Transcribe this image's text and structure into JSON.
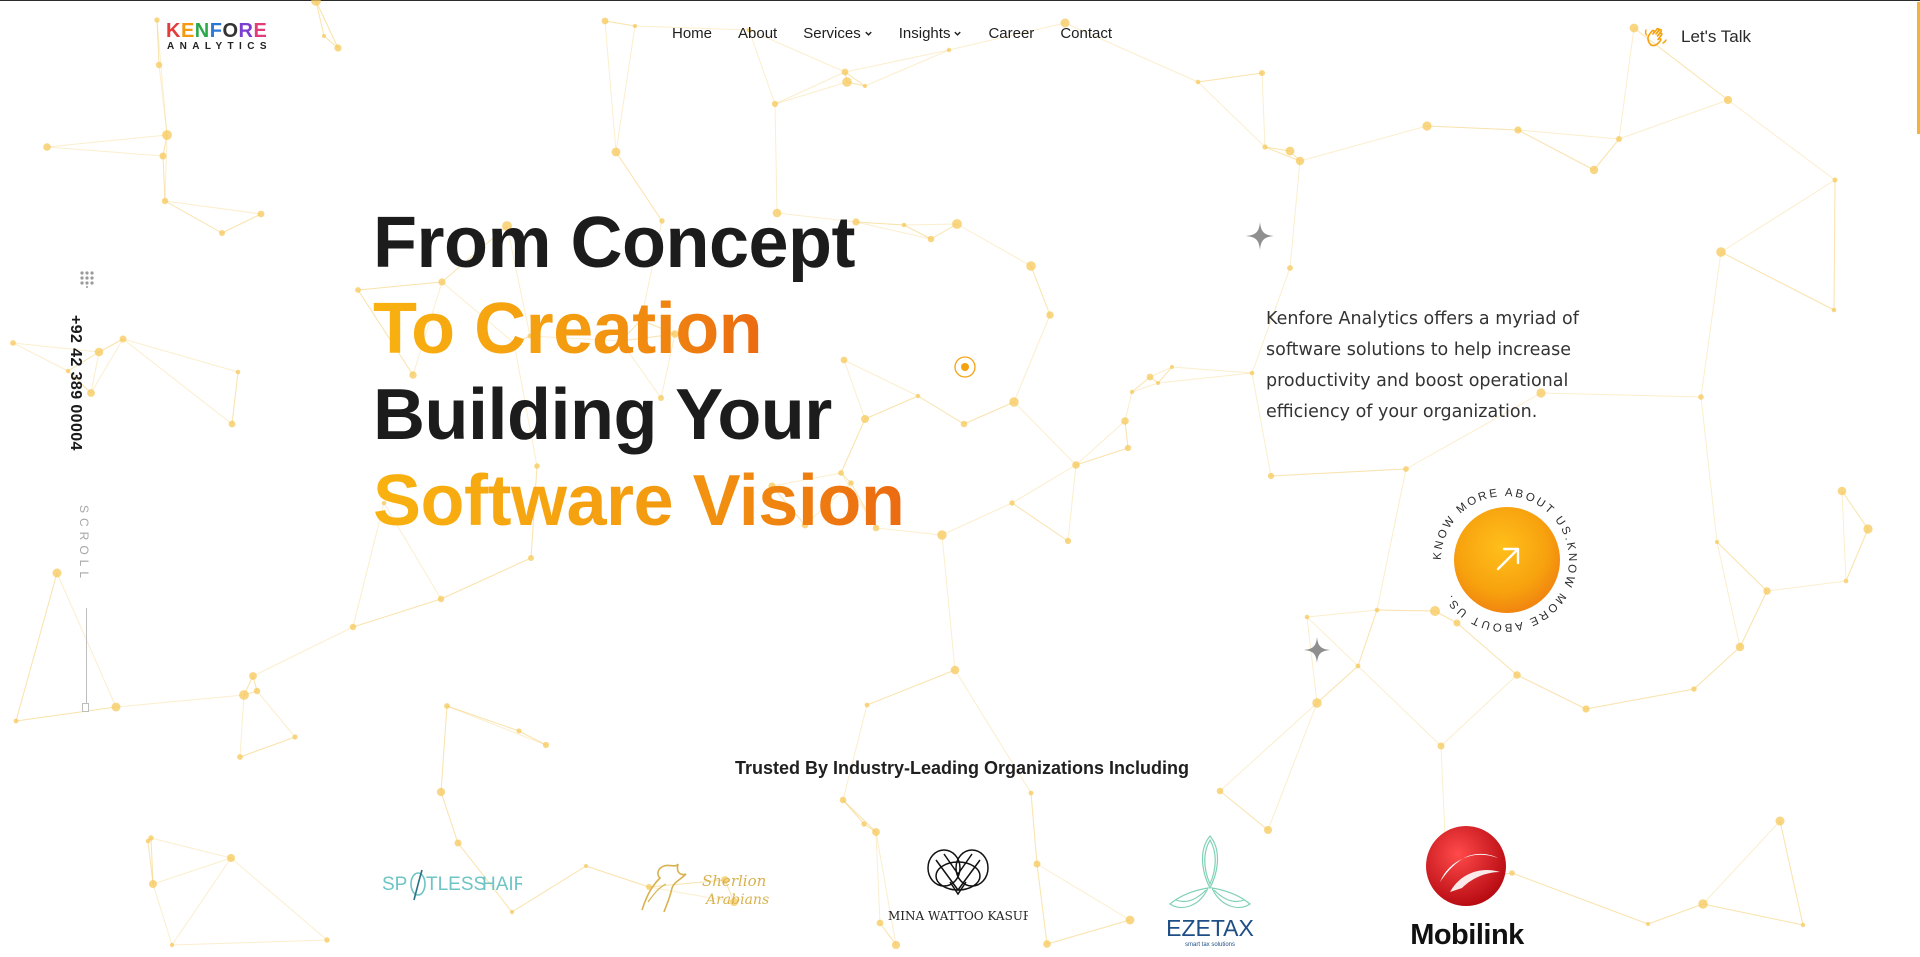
{
  "brand": {
    "logo_top": "KENFORE",
    "logo_bottom": "ANALYTICS",
    "accent_color": "#f5a20f",
    "accent_dark": "#eb6a11"
  },
  "nav": {
    "items": [
      {
        "label": "Home",
        "dropdown": false
      },
      {
        "label": "About",
        "dropdown": false
      },
      {
        "label": "Services",
        "dropdown": true
      },
      {
        "label": "Insights",
        "dropdown": true
      },
      {
        "label": "Career",
        "dropdown": false
      },
      {
        "label": "Contact",
        "dropdown": false
      }
    ],
    "cta_label": "Let's Talk",
    "cta_icon": "waving-hand-icon"
  },
  "side_rail": {
    "phone": "+92 42 389 00004",
    "scroll_label": "SCROLL"
  },
  "hero": {
    "line1": "From Concept",
    "line2": "To Creation",
    "line3": "Building Your",
    "line4": "Software Vision",
    "description": "Kenfore Analytics offers a myriad of software solutions to help increase productivity and boost operational efficiency of your organization.",
    "circle_text": "KNOW MORE ABOUT US.KNOW MORE ABOUT US.",
    "circle_icon": "arrow-up-right-icon"
  },
  "clients": {
    "heading": "Trusted By Industry-Leading Organizations Including",
    "logos": [
      {
        "name": "Spotless Hair",
        "text_a": "SP",
        "text_b": "TLESS",
        "text_c": "HAIR"
      },
      {
        "name": "Sherlion Arabians",
        "text_a": "Sherlion",
        "text_b": "Arabians"
      },
      {
        "name": "Amina Wattoo Kasuri",
        "text_a": "AMINA WATTOO KASURI"
      },
      {
        "name": "Ezetax",
        "text_a": "EZETAX",
        "text_b": "smart tax solutions"
      },
      {
        "name": "Mobilink",
        "text_a": "Mobilink"
      }
    ]
  }
}
